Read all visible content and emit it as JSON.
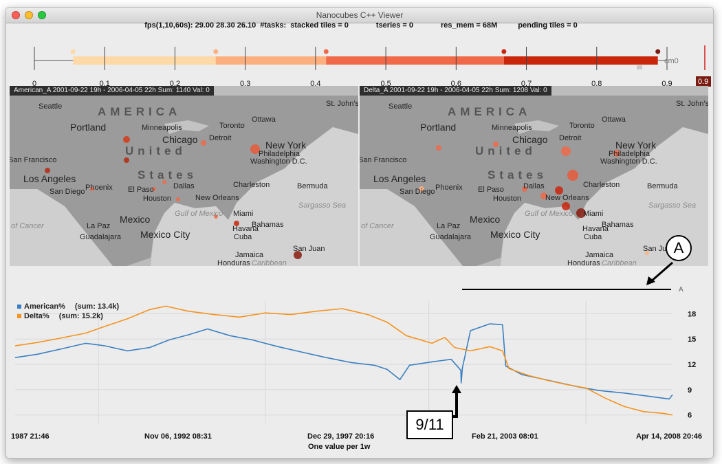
{
  "window": {
    "title": "Nanocubes C++ Viewer",
    "stats": {
      "fps": "fps(1,10,60s): 29.00 28.30 26.10",
      "tasks": "#tasks:",
      "stacked": "stacked tiles = 0",
      "tseries": "tseries = 0",
      "res_mem": "res_mem = 68M",
      "pending": "pending tiles = 0"
    }
  },
  "colormap_slider": {
    "ticks": [
      "0",
      "0.1",
      "0.2",
      "0.3",
      "0.4",
      "0.5",
      "0.6",
      "0.7",
      "0.8",
      "0.9"
    ],
    "segment_stops": [
      0.055,
      0.258,
      0.415,
      0.668,
      0.887
    ],
    "segment_colors": [
      "#fdd9a8",
      "#fdb07f",
      "#f06a4a",
      "#c9260c"
    ],
    "end_label": "cm0",
    "value_badge": "0.9",
    "marker_value": 0.905
  },
  "maps": [
    {
      "header": "American_A    2001-09-22 19h - 2006-04-05 22h Sum: 1140 Val: 0",
      "labels": {
        "america": "AMERICA",
        "united": "United",
        "states": "States",
        "seattle": "Seattle",
        "portland": "Portland",
        "minneapolis": "Minneapolis",
        "toronto": "Toronto",
        "ottawa": "Ottawa",
        "stjohns": "St. John's",
        "chicago": "Chicago",
        "detroit": "Detroit",
        "newyork": "New York",
        "philadelphia": "Philadelphia",
        "washington": "Washington D.C.",
        "sanfrancisco": "San Francisco",
        "losangeles": "Los Angeles",
        "sandiego": "San Diego",
        "phoenix": "Phoenix",
        "elpaso": "El Paso",
        "dallas": "Dallas",
        "houston": "Houston",
        "neworleans": "New Orleans",
        "charleston": "Charleston",
        "bermuda": "Bermuda",
        "sargasso": "Sargasso Sea",
        "miami": "Miami",
        "havana": "Havana",
        "cuba": "Cuba",
        "bahamas": "Bahamas",
        "mexico": "Mexico",
        "gulf": "Gulf of Mexico",
        "lapaz": "La Paz",
        "guadalajara": "Guadalajara",
        "mexicocity": "Mexico City",
        "tropic": "of Cancer",
        "jamaica": "Jamaica",
        "sanjuan": "San Juan",
        "honduras": "Honduras",
        "caribbean": "Caribbean"
      }
    },
    {
      "header": "Delta_A    2001-09-22 19h - 2006-04-05 22h Sum: 1208 Val: 0",
      "labels": {
        "america": "AMERICA",
        "united": "United",
        "states": "States",
        "seattle": "Seattle",
        "portland": "Portland",
        "minneapolis": "Minneapolis",
        "toronto": "Toronto",
        "ottawa": "Ottawa",
        "stjohns": "St. John's",
        "chicago": "Chicago",
        "detroit": "Detroit",
        "newyork": "New York",
        "philadelphia": "Philadelphia",
        "washington": "Washington D.C.",
        "sanfrancisco": "San Francisco",
        "losangeles": "Los Angeles",
        "sandiego": "San Diego",
        "phoenix": "Phoenix",
        "elpaso": "El Paso",
        "dallas": "Dallas",
        "houston": "Houston",
        "neworleans": "New Orleans",
        "charleston": "Charleston",
        "bermuda": "Bermuda",
        "sargasso": "Sargasso Sea",
        "miami": "Miami",
        "havana": "Havana",
        "cuba": "Cuba",
        "bahamas": "Bahamas",
        "mexico": "Mexico",
        "gulf": "Gulf of Mexico",
        "lapaz": "La Paz",
        "guadalajara": "Guadalajara",
        "mexicocity": "Mexico City",
        "tropic": "of Cancer",
        "jamaica": "Jamaica",
        "sanjuan": "San Juan",
        "honduras": "Honduras",
        "caribbean": "Caribbean"
      }
    }
  ],
  "annotations": {
    "a": "A",
    "a_small": "A",
    "event": "9/11"
  },
  "chart_data": {
    "type": "line",
    "series": [
      {
        "name": "American%",
        "sum_label": "(sum: 13.4k)",
        "color": "#3a7fc1",
        "values": [
          [
            1987.8,
            12.8
          ],
          [
            1988.5,
            13.2
          ],
          [
            1989.2,
            13.8
          ],
          [
            1990.0,
            14.5
          ],
          [
            1990.6,
            14.2
          ],
          [
            1991.3,
            13.6
          ],
          [
            1992.0,
            14.0
          ],
          [
            1992.6,
            14.9
          ],
          [
            1993.2,
            15.5
          ],
          [
            1993.8,
            16.2
          ],
          [
            1994.5,
            15.4
          ],
          [
            1995.2,
            14.9
          ],
          [
            1996.0,
            14.1
          ],
          [
            1996.8,
            13.4
          ],
          [
            1997.5,
            12.8
          ],
          [
            1998.3,
            12.2
          ],
          [
            1999.0,
            11.9
          ],
          [
            1999.4,
            11.4
          ],
          [
            1999.8,
            10.2
          ],
          [
            2000.1,
            11.9
          ],
          [
            2000.8,
            12.3
          ],
          [
            2001.4,
            12.6
          ],
          [
            2001.7,
            11.3
          ],
          [
            2001.71,
            9.8
          ],
          [
            2001.75,
            11.6
          ],
          [
            2002.0,
            16.0
          ],
          [
            2002.6,
            16.8
          ],
          [
            2003.0,
            16.7
          ],
          [
            2003.1,
            11.8
          ],
          [
            2003.6,
            10.8
          ],
          [
            2004.2,
            10.3
          ],
          [
            2004.8,
            9.8
          ],
          [
            2005.4,
            9.3
          ],
          [
            2006.0,
            8.9
          ],
          [
            2006.8,
            8.6
          ],
          [
            2007.6,
            8.2
          ],
          [
            2008.2,
            7.9
          ],
          [
            2008.3,
            8.4
          ]
        ]
      },
      {
        "name": "Delta%",
        "sum_label": "(sum: 15.2k)",
        "color": "#f4931e",
        "values": [
          [
            1987.8,
            14.2
          ],
          [
            1988.5,
            14.6
          ],
          [
            1989.2,
            15.1
          ],
          [
            1990.0,
            15.7
          ],
          [
            1990.6,
            16.5
          ],
          [
            1991.3,
            17.4
          ],
          [
            1992.0,
            18.5
          ],
          [
            1992.5,
            18.9
          ],
          [
            1993.2,
            18.3
          ],
          [
            1994.0,
            17.9
          ],
          [
            1994.8,
            17.6
          ],
          [
            1995.6,
            18.1
          ],
          [
            1996.4,
            17.9
          ],
          [
            1997.2,
            18.3
          ],
          [
            1998.0,
            18.6
          ],
          [
            1998.8,
            17.9
          ],
          [
            1999.4,
            17.0
          ],
          [
            2000.0,
            15.4
          ],
          [
            2000.8,
            14.5
          ],
          [
            2001.2,
            15.2
          ],
          [
            2001.5,
            14.0
          ],
          [
            2002.0,
            13.6
          ],
          [
            2002.6,
            14.1
          ],
          [
            2003.0,
            13.6
          ],
          [
            2003.2,
            11.5
          ],
          [
            2003.8,
            10.7
          ],
          [
            2004.4,
            10.1
          ],
          [
            2005.0,
            9.6
          ],
          [
            2005.6,
            9.2
          ],
          [
            2006.2,
            8.0
          ],
          [
            2006.8,
            7.0
          ],
          [
            2007.4,
            6.4
          ],
          [
            2008.0,
            6.2
          ],
          [
            2008.3,
            6.0
          ]
        ]
      }
    ],
    "yticks": [
      "18",
      "15",
      "12",
      "9",
      "6"
    ],
    "ylim": [
      5,
      19.5
    ],
    "xlim": [
      1987.8,
      2008.3
    ],
    "xtick_labels": [
      "1987 21:46",
      "Nov 06, 1992 08:31",
      "Dec 29, 1997 20:16",
      "Feb 21, 2003 08:01",
      "Apr 14, 2008 20:46"
    ],
    "xlabel": "One value per 1w",
    "legend_position": "top-left"
  }
}
